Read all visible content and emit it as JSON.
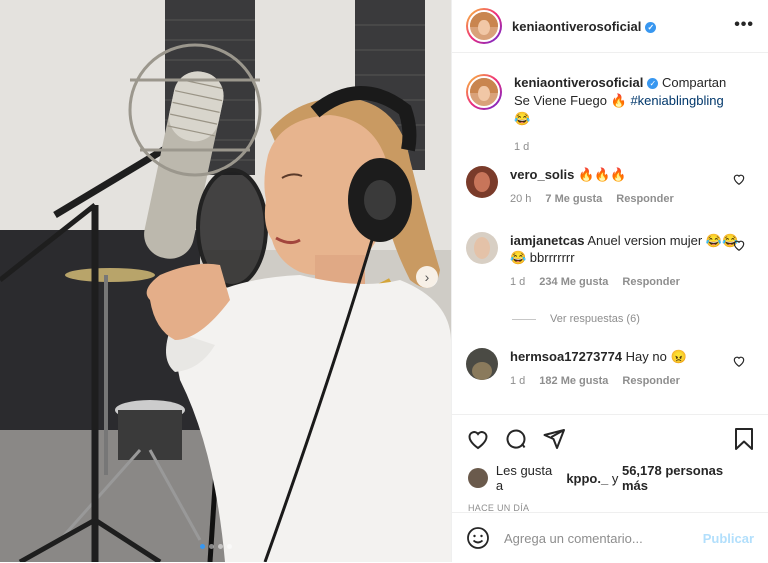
{
  "post": {
    "username": "keniaontiverosoficial",
    "more_icon": "more-horizontal-icon",
    "caption": {
      "username": "keniaontiverosoficial",
      "text": "Compartan Se Viene Fuego 🔥",
      "hashtag": "#keniablingbling",
      "emoji": "😂",
      "time": "1 d"
    },
    "comments": [
      {
        "username": "vero_solis",
        "text": "🔥🔥🔥",
        "time": "20 h",
        "likes": "7 Me gusta",
        "reply": "Responder"
      },
      {
        "username": "iamjanetcas",
        "text": "Anuel version mujer 😂😂😂 bbrrrrrrr",
        "time": "1 d",
        "likes": "234 Me gusta",
        "reply": "Responder",
        "view_replies": "Ver respuestas (6)"
      },
      {
        "username": "hermsoa17273774",
        "text": "Hay no 😠",
        "time": "1 d",
        "likes": "182 Me gusta",
        "reply": "Responder"
      }
    ],
    "likes_text_prefix": "Les gusta a",
    "likes_user": "kppo._",
    "likes_text_mid": "y",
    "likes_count": "56,178 personas más",
    "time_ago": "HACE UN DÍA",
    "comment_placeholder": "Agrega un comentario...",
    "publish_label": "Publicar",
    "colors": {
      "verified": "#3897f0",
      "hashtag": "#00376b",
      "publish": "#b2dffc"
    }
  }
}
